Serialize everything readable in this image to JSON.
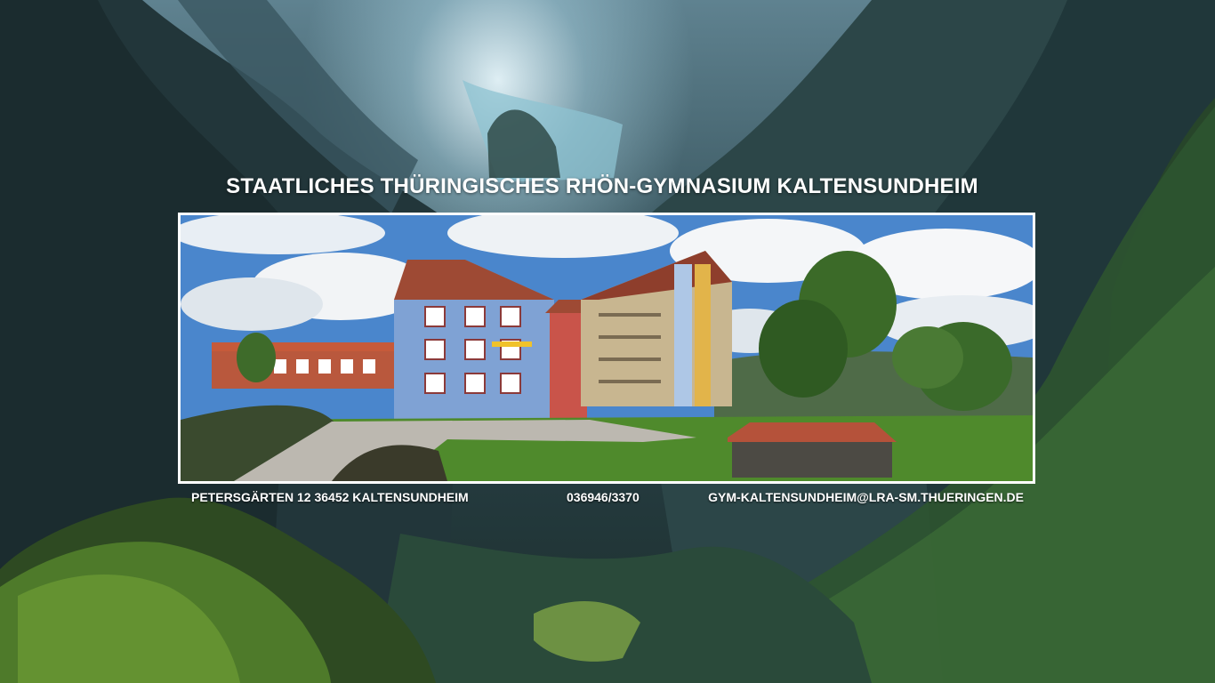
{
  "header": {
    "title": "STAATLICHES THÜRINGISCHES RHÖN-GYMNASIUM KALTENSUNDHEIM"
  },
  "contact": {
    "address": "PETERSGÄRTEN 12   36452 KALTENSUNDHEIM",
    "phone": "036946/3370",
    "email": "GYM-KALTENSUNDHEIM@LRA-SM.THUERINGEN.DE"
  },
  "colors": {
    "title_text": "#ffffff",
    "photo_border": "#ffffff",
    "background_dark": "#1f3338"
  }
}
